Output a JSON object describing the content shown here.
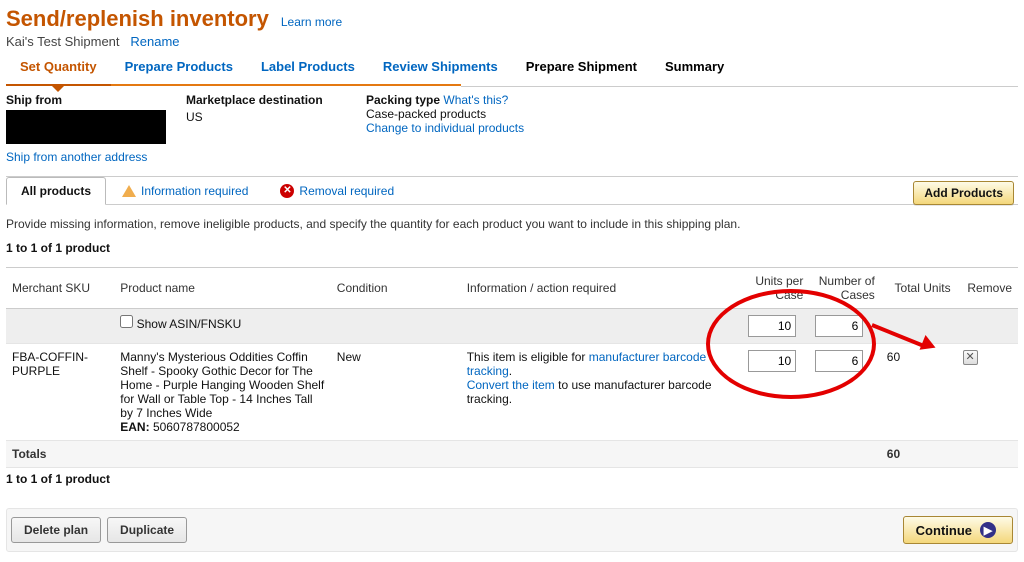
{
  "header": {
    "title": "Send/replenish inventory",
    "learn_more": "Learn more",
    "shipment_name": "Kai's Test Shipment",
    "rename": "Rename"
  },
  "tabs": {
    "t1": "Set Quantity",
    "t2": "Prepare Products",
    "t3": "Label Products",
    "t4": "Review Shipments",
    "t5": "Prepare Shipment",
    "t6": "Summary"
  },
  "info": {
    "ship_from_label": "Ship from",
    "ship_other": "Ship from another address",
    "market_label": "Marketplace destination",
    "market_value": "US",
    "packing_label": "Packing type",
    "whats_this": "What's this?",
    "packing_value": "Case-packed products",
    "packing_change": "Change to individual products"
  },
  "filters": {
    "all": "All products",
    "info_req": "Information required",
    "removal_req": "Removal required",
    "add_products": "Add Products"
  },
  "instructions": "Provide missing information, remove ineligible products, and specify the quantity for each product you want to include in this shipping plan.",
  "pager": "1 to 1 of 1 product",
  "table": {
    "headers": {
      "sku": "Merchant SKU",
      "name": "Product name",
      "condition": "Condition",
      "action": "Information / action required",
      "units_per": "Units per Case",
      "num_cases": "Number of Cases",
      "total": "Total Units",
      "remove": "Remove"
    },
    "show_asin": "Show ASIN/FNSKU",
    "defaults": {
      "units_per": "10",
      "num_cases": "6"
    },
    "row": {
      "sku": "FBA-COFFIN-PURPLE",
      "name": "Manny's Mysterious Oddities Coffin Shelf - Spooky Gothic Decor for The Home - Purple Hanging Wooden Shelf for Wall or Table Top - 14 Inches Tall by 7 Inches Wide",
      "ean_label": "EAN:",
      "ean": "5060787800052",
      "condition": "New",
      "action_pre": "This item is eligible for ",
      "action_link1": "manufacturer barcode tracking",
      "action_link2": "Convert the item",
      "action_post": " to use manufacturer barcode tracking.",
      "units_per": "10",
      "num_cases": "6",
      "total": "60"
    },
    "totals_label": "Totals",
    "totals_value": "60"
  },
  "footer": {
    "delete": "Delete plan",
    "duplicate": "Duplicate",
    "continue": "Continue"
  }
}
